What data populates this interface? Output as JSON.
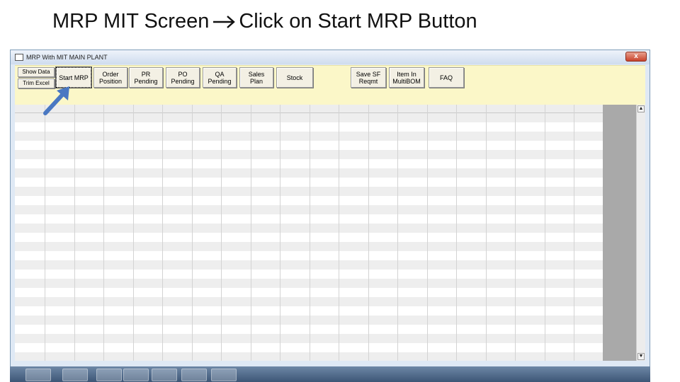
{
  "slide": {
    "title_left": "MRP MIT Screen",
    "title_right": "Click on Start MRP Button"
  },
  "window": {
    "title": "MRP With MIT MAIN PLANT",
    "close_label": "x"
  },
  "toolbar": {
    "buttons": [
      {
        "label": "Show Data"
      },
      {
        "label": "Trim Excel"
      },
      {
        "label": "Start MRP"
      },
      {
        "label": "Order\nPosition"
      },
      {
        "label": "PR\nPending"
      },
      {
        "label": "PO\nPending"
      },
      {
        "label": "QA\nPending"
      },
      {
        "label": "Sales\nPlan"
      },
      {
        "label": "Stock"
      },
      {
        "label": "Save SF\nReqmt"
      },
      {
        "label": "Item In\nMultiBOM"
      },
      {
        "label": "FAQ"
      }
    ]
  },
  "scrollbar": {
    "up_symbol": "▲",
    "down_symbol": "▼"
  },
  "colors": {
    "toolbar_bg": "#fbf7c8",
    "grid_stripe": "#eeeeee",
    "grid_gray": "#a9a9a9",
    "pointer_arrow": "#4a78c2"
  }
}
